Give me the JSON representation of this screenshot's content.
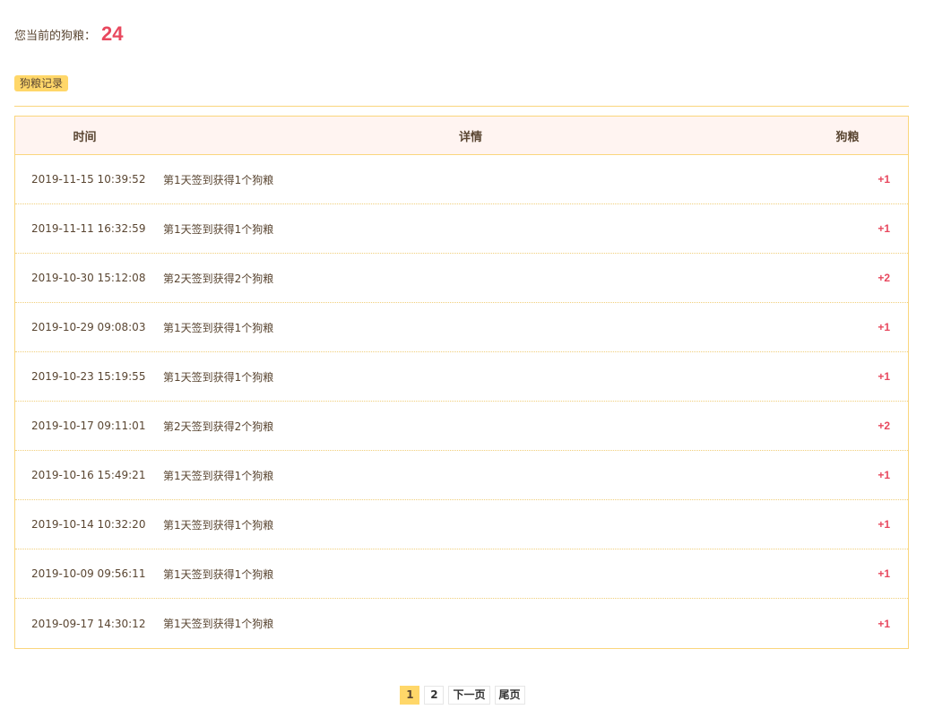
{
  "balance": {
    "label": "您当前的狗粮：",
    "value": "24"
  },
  "tab": {
    "label": "狗粮记录"
  },
  "table": {
    "headers": {
      "time": "时间",
      "detail": "详情",
      "points": "狗粮"
    },
    "rows": [
      {
        "time": "2019-11-15 10:39:52",
        "detail": "第1天签到获得1个狗粮",
        "points": "+1"
      },
      {
        "time": "2019-11-11 16:32:59",
        "detail": "第1天签到获得1个狗粮",
        "points": "+1"
      },
      {
        "time": "2019-10-30 15:12:08",
        "detail": "第2天签到获得2个狗粮",
        "points": "+2"
      },
      {
        "time": "2019-10-29 09:08:03",
        "detail": "第1天签到获得1个狗粮",
        "points": "+1"
      },
      {
        "time": "2019-10-23 15:19:55",
        "detail": "第1天签到获得1个狗粮",
        "points": "+1"
      },
      {
        "time": "2019-10-17 09:11:01",
        "detail": "第2天签到获得2个狗粮",
        "points": "+2"
      },
      {
        "time": "2019-10-16 15:49:21",
        "detail": "第1天签到获得1个狗粮",
        "points": "+1"
      },
      {
        "time": "2019-10-14 10:32:20",
        "detail": "第1天签到获得1个狗粮",
        "points": "+1"
      },
      {
        "time": "2019-10-09 09:56:11",
        "detail": "第1天签到获得1个狗粮",
        "points": "+1"
      },
      {
        "time": "2019-09-17 14:30:12",
        "detail": "第1天签到获得1个狗粮",
        "points": "+1"
      }
    ]
  },
  "pagination": {
    "pages": [
      "1",
      "2"
    ],
    "current": "1",
    "next_label": "下一页",
    "last_label": "尾页"
  },
  "colors": {
    "accent": "#ffd769",
    "points": "#e8485e",
    "border": "#fad67d",
    "header_bg": "#fff4f1"
  }
}
